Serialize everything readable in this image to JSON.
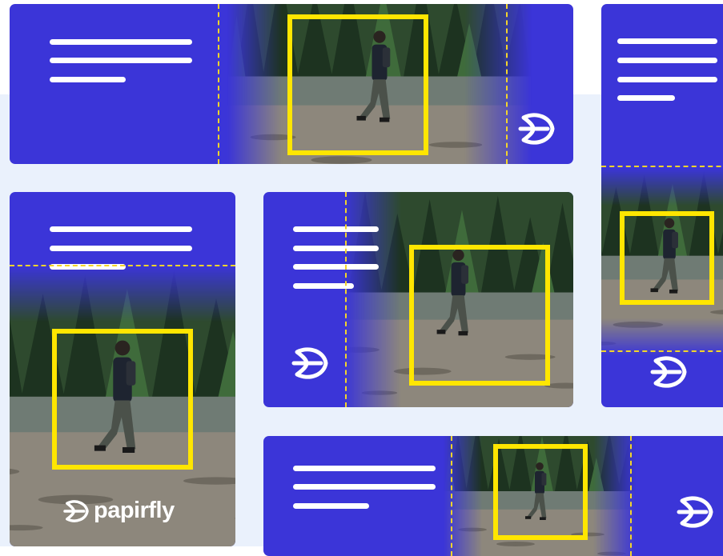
{
  "brand": {
    "name": "papirfly",
    "accent": "#3b35d8",
    "focus_color": "#ffe600",
    "guide_color": "#f3d52a",
    "background": "#eaf1fc",
    "logo_icon": "papirfly-leaf-icon"
  },
  "crops": [
    {
      "id": "leaderboard",
      "text_lines": 3
    },
    {
      "id": "skyscraper",
      "text_lines": 4
    },
    {
      "id": "portrait",
      "text_lines": 3
    },
    {
      "id": "landscape",
      "text_lines": 4
    },
    {
      "id": "banner",
      "text_lines": 3
    }
  ]
}
